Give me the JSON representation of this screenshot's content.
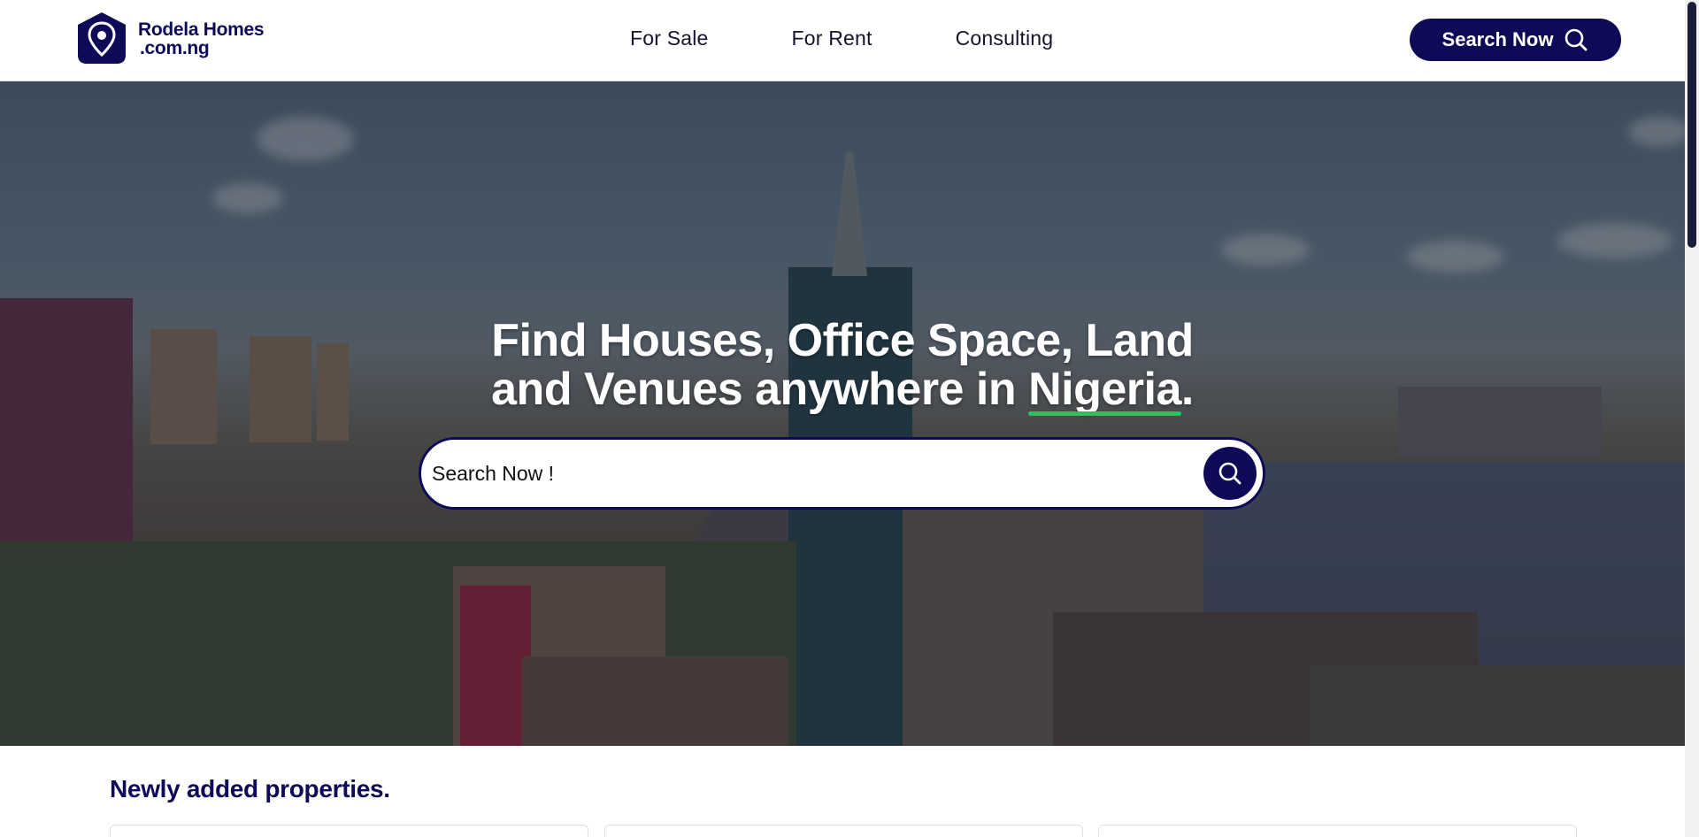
{
  "brand": {
    "name_line1": "Rodela Homes",
    "name_line2": ".com.ng",
    "color": "#0d0a57"
  },
  "nav": {
    "items": [
      {
        "label": "For Sale"
      },
      {
        "label": "For Rent"
      },
      {
        "label": "Consulting"
      }
    ],
    "search_button_label": "Search Now",
    "search_icon": "search-icon"
  },
  "hero": {
    "headline_line1": "Find Houses, Office Space, Land",
    "headline_line2_prefix": "and Venues anywhere in ",
    "headline_highlight": "Nigeria",
    "headline_suffix": ".",
    "highlight_color": "#22c55e",
    "search_placeholder": "Search Now !",
    "search_icon": "search-icon"
  },
  "listings": {
    "section_title": "Newly added properties."
  }
}
